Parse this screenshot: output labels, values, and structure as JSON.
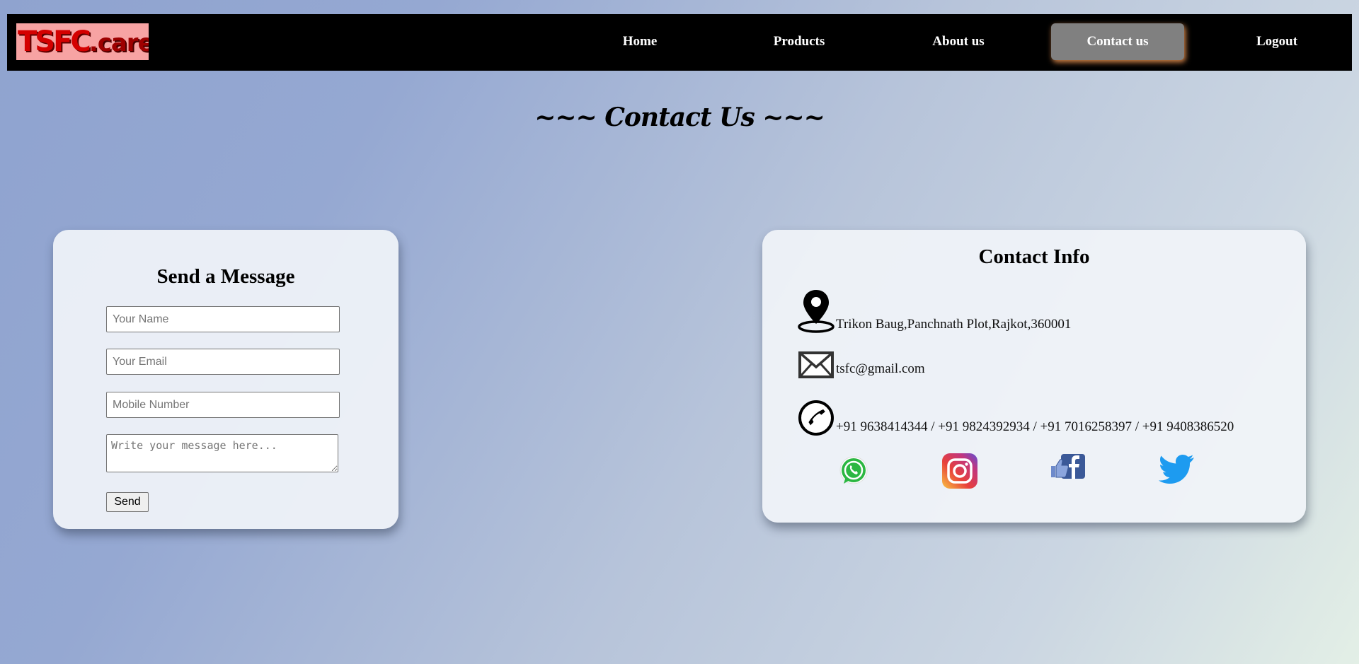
{
  "nav": {
    "logo": {
      "part1": "TSFC",
      "part2": ".care"
    },
    "links": [
      "Home",
      "Products",
      "About us",
      "Contact us",
      "Logout"
    ],
    "active": "Contact us",
    "active_color": "#808080"
  },
  "page_title": "~~~ Contact Us ~~~",
  "message_form": {
    "heading": "Send a Message",
    "name_placeholder": "Your Name",
    "email_placeholder": "Your Email",
    "mobile_placeholder": "Mobile Number",
    "message_placeholder": "Write your message here...",
    "send_label": "Send"
  },
  "contact_info": {
    "heading": "Contact Info",
    "address": "Trikon Baug,Panchnath Plot,Rajkot,360001",
    "email": "tsfc@gmail.com",
    "phones": "+91 9638414344 / +91 9824392934 / +91 7016258397 / +91 9408386520",
    "icons": [
      "location-pin-icon",
      "mail-icon",
      "phone-icon"
    ],
    "social": [
      "whatsapp-icon",
      "instagram-icon",
      "facebook-icon",
      "twitter-icon"
    ]
  }
}
